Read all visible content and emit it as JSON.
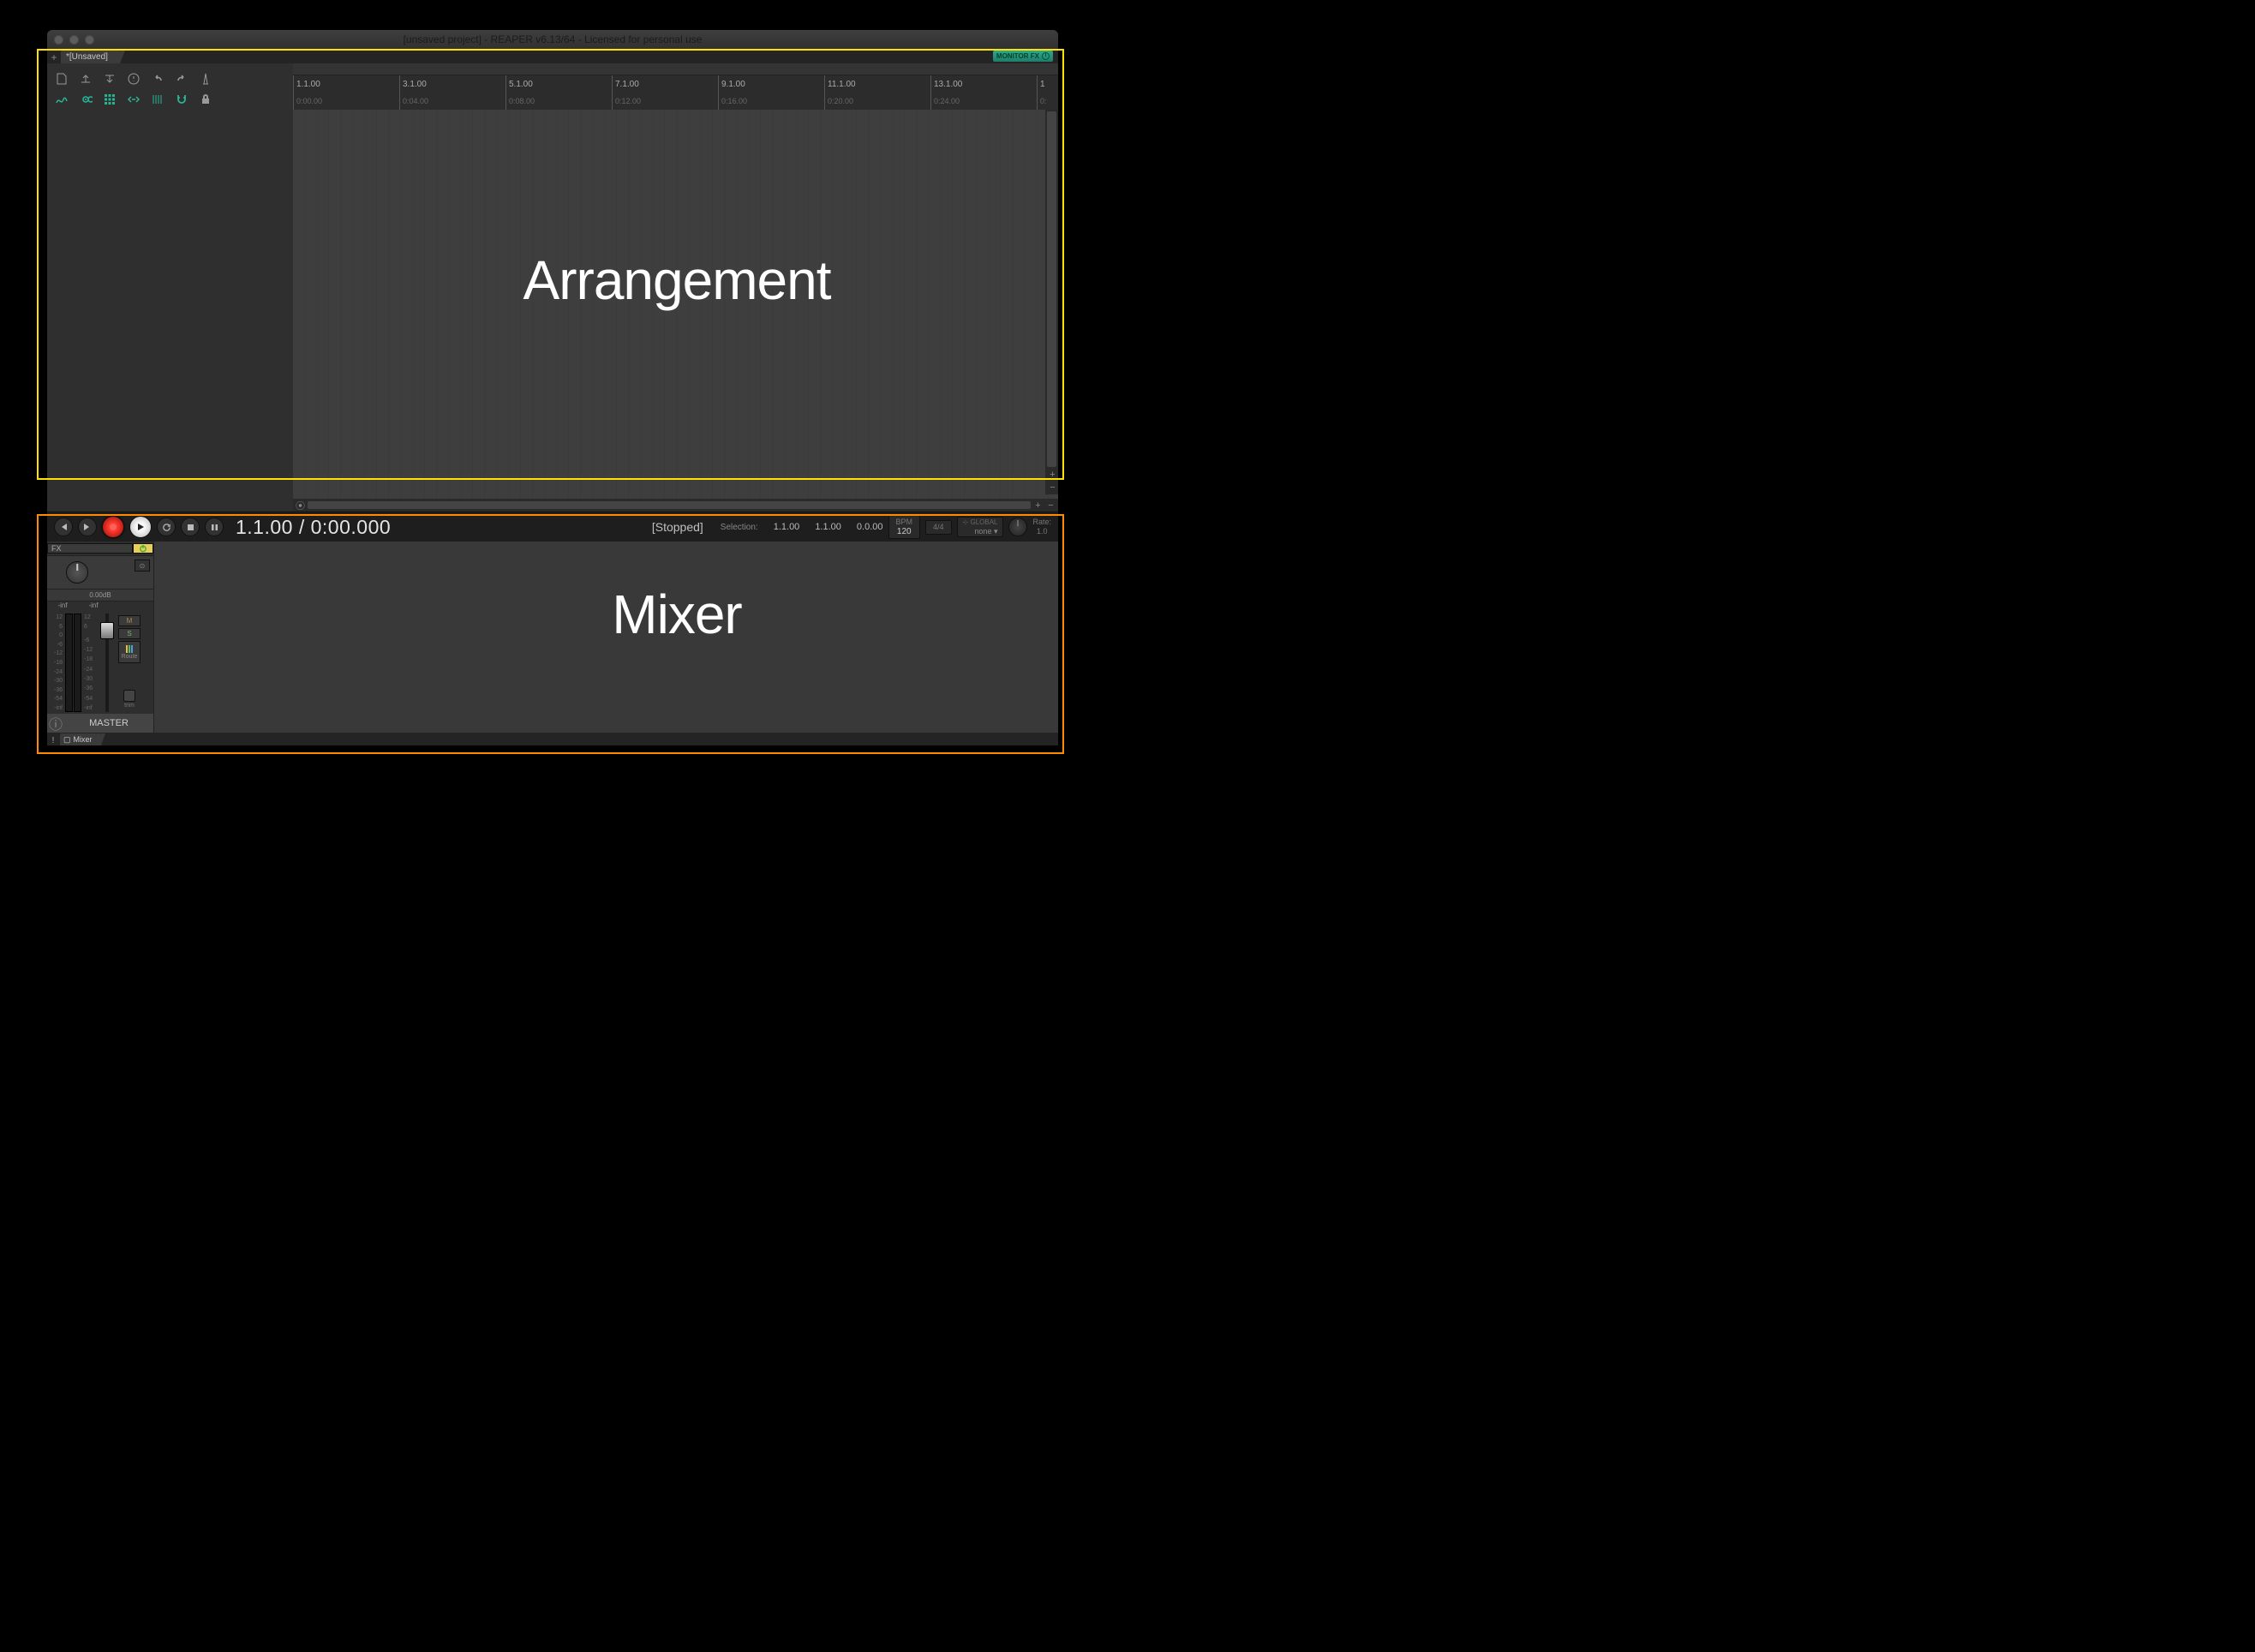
{
  "window": {
    "title": "[unsaved project] - REAPER v6.13/64 - Licensed for personal use"
  },
  "tabs": {
    "project": "*[Unsaved]",
    "monitor_fx": "MONITOR FX"
  },
  "ruler": {
    "ticks": [
      {
        "bar": "1.1.00",
        "time": "0:00.00"
      },
      {
        "bar": "3.1.00",
        "time": "0:04.00"
      },
      {
        "bar": "5.1.00",
        "time": "0:08.00"
      },
      {
        "bar": "7.1.00",
        "time": "0:12.00"
      },
      {
        "bar": "9.1.00",
        "time": "0:16.00"
      },
      {
        "bar": "11.1.00",
        "time": "0:20.00"
      },
      {
        "bar": "13.1.00",
        "time": "0:24.00"
      }
    ],
    "partial": {
      "bar": "1",
      "time": "0:"
    }
  },
  "transport": {
    "position": "1.1.00 / 0:00.000",
    "state": "[Stopped]",
    "selection_label": "Selection:",
    "sel_start": "1.1.00",
    "sel_end": "1.1.00",
    "sel_len": "0.0.00",
    "bpm_label": "BPM",
    "bpm": "120",
    "sig": "4/4",
    "auto_global": "GLOBAL",
    "auto_mode": "none",
    "rate_label": "Rate:",
    "rate": "1.0"
  },
  "mixer": {
    "fx_label": "FX",
    "vol_db": "0.00dB",
    "peak_l": "-inf",
    "peak_r": "-inf",
    "scale": [
      "12",
      "6",
      "0",
      "-6",
      "-12",
      "-18",
      "-24",
      "-30",
      "-36",
      "-54",
      "-inf"
    ],
    "scale2": [
      "12",
      "6",
      "",
      "-6",
      "-12",
      "-18",
      "-24",
      "-30",
      "-36",
      "-54",
      "-inf"
    ],
    "mute": "M",
    "solo": "S",
    "route": "Route",
    "trim": "trim",
    "mono": "⊙",
    "master": "MASTER",
    "tab": "Mixer"
  },
  "annotations": {
    "arrangement": "Arrangement",
    "mixer": "Mixer"
  }
}
